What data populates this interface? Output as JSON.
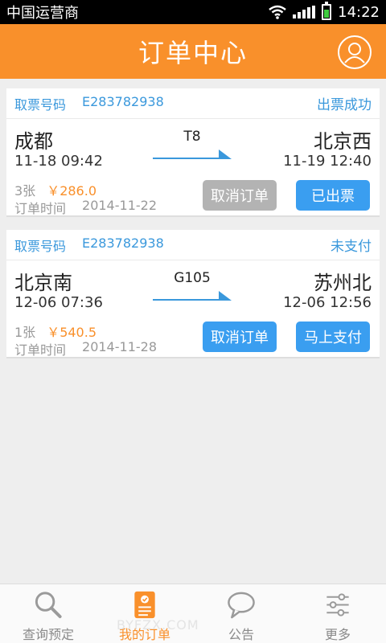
{
  "statusbar": {
    "carrier": "中国运营商",
    "time": "14:22"
  },
  "header": {
    "title": "订单中心"
  },
  "orders": [
    {
      "ticket_label": "取票号码",
      "ticket_no": "E283782938",
      "status": "出票成功",
      "from": "成都",
      "to": "北京西",
      "train": "T8",
      "depart": "11-18  09:42",
      "arrive": "11-19  12:40",
      "count": "3张",
      "price": "￥286.0",
      "order_time_label": "订单时间",
      "order_time": "2014-11-22",
      "btn_left": "取消订单",
      "btn_right": "已出票"
    },
    {
      "ticket_label": "取票号码",
      "ticket_no": "E283782938",
      "status": "未支付",
      "from": "北京南",
      "to": "苏州北",
      "train": "G105",
      "depart": "12-06  07:36",
      "arrive": "12-06  12:56",
      "count": "1张",
      "price": "￥540.5",
      "order_time_label": "订单时间",
      "order_time": "2014-11-28",
      "btn_left": "取消订单",
      "btn_right": "马上支付"
    }
  ],
  "tabs": [
    {
      "label": "查询预定",
      "icon": "search-icon"
    },
    {
      "label": "我的订单",
      "icon": "order-icon"
    },
    {
      "label": "公告",
      "icon": "chat-bubble-icon"
    },
    {
      "label": "更多",
      "icon": "settings-sliders-icon"
    }
  ],
  "watermark": "BYFZX.COM",
  "colors": {
    "accent": "#f9902b",
    "blue": "#3a9ef0",
    "grey_button": "#b3b3b3"
  }
}
